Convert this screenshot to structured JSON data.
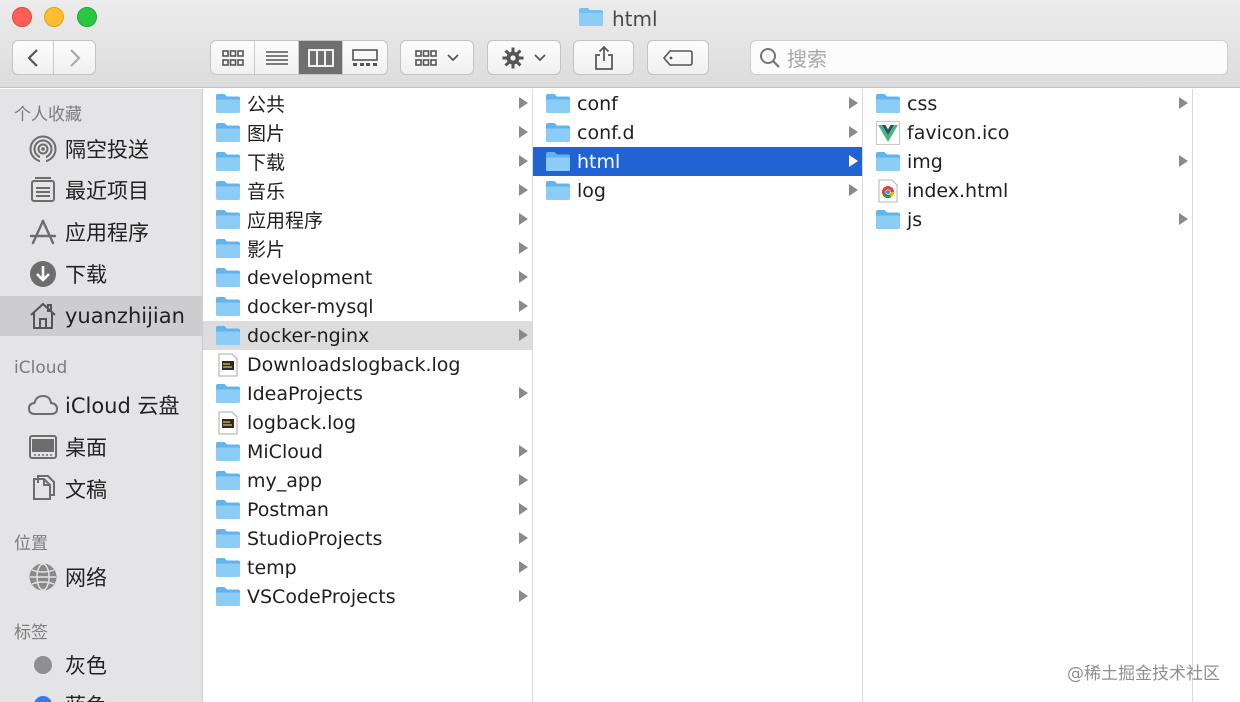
{
  "window": {
    "title": "html"
  },
  "toolbar": {
    "back_icon": "chevron-left-icon",
    "forward_icon": "chevron-right-icon",
    "view_modes": [
      "icon-view",
      "list-view",
      "column-view",
      "gallery-view"
    ],
    "active_view": "column-view",
    "group_icon": "grid-icon",
    "action_icon": "gear-icon",
    "share_icon": "share-icon",
    "tag_icon": "tag-icon",
    "search_placeholder": "搜索"
  },
  "sidebar": {
    "favorites_label": "个人收藏",
    "favorites": [
      {
        "label": "隔空投送",
        "icon": "airdrop-icon"
      },
      {
        "label": "最近项目",
        "icon": "recents-icon"
      },
      {
        "label": "应用程序",
        "icon": "applications-icon"
      },
      {
        "label": "下载",
        "icon": "downloads-icon"
      },
      {
        "label": "yuanzhijian",
        "icon": "home-icon",
        "selected": true
      }
    ],
    "icloud_label": "iCloud",
    "icloud": [
      {
        "label": "iCloud 云盘",
        "icon": "cloud-icon"
      },
      {
        "label": "桌面",
        "icon": "desktop-icon"
      },
      {
        "label": "文稿",
        "icon": "documents-icon"
      }
    ],
    "locations_label": "位置",
    "locations": [
      {
        "label": "网络",
        "icon": "network-icon"
      }
    ],
    "tags_label": "标签",
    "tags": [
      {
        "label": "灰色",
        "color": "#8e8e93"
      },
      {
        "label": "蓝色",
        "color": "#3478f6"
      }
    ]
  },
  "columns": [
    {
      "items": [
        {
          "name": "公共",
          "type": "folder",
          "arrow": true
        },
        {
          "name": "图片",
          "type": "folder",
          "arrow": true
        },
        {
          "name": "下载",
          "type": "folder",
          "arrow": true
        },
        {
          "name": "音乐",
          "type": "folder",
          "arrow": true
        },
        {
          "name": "应用程序",
          "type": "folder",
          "arrow": true
        },
        {
          "name": "影片",
          "type": "folder",
          "arrow": true
        },
        {
          "name": "development",
          "type": "folder",
          "arrow": true
        },
        {
          "name": "docker-mysql",
          "type": "folder",
          "arrow": true
        },
        {
          "name": "docker-nginx",
          "type": "folder",
          "arrow": true,
          "selected": "gray"
        },
        {
          "name": "Downloadslogback.log",
          "type": "log",
          "arrow": false
        },
        {
          "name": "IdeaProjects",
          "type": "folder",
          "arrow": true
        },
        {
          "name": "logback.log",
          "type": "log",
          "arrow": false
        },
        {
          "name": "MiCloud",
          "type": "folder",
          "arrow": true
        },
        {
          "name": "my_app",
          "type": "folder",
          "arrow": true
        },
        {
          "name": "Postman",
          "type": "folder",
          "arrow": true
        },
        {
          "name": "StudioProjects",
          "type": "folder",
          "arrow": true
        },
        {
          "name": "temp",
          "type": "folder",
          "arrow": true
        },
        {
          "name": "VSCodeProjects",
          "type": "folder",
          "arrow": true
        }
      ]
    },
    {
      "items": [
        {
          "name": "conf",
          "type": "folder",
          "arrow": true
        },
        {
          "name": "conf.d",
          "type": "folder",
          "arrow": true
        },
        {
          "name": "html",
          "type": "folder",
          "arrow": true,
          "selected": "blue"
        },
        {
          "name": "log",
          "type": "folder",
          "arrow": true
        }
      ]
    },
    {
      "items": [
        {
          "name": "css",
          "type": "folder",
          "arrow": true
        },
        {
          "name": "favicon.ico",
          "type": "vue",
          "arrow": false
        },
        {
          "name": "img",
          "type": "folder",
          "arrow": true
        },
        {
          "name": "index.html",
          "type": "chrome",
          "arrow": false
        },
        {
          "name": "js",
          "type": "folder",
          "arrow": true
        }
      ]
    }
  ],
  "watermark": "@稀土掘金技术社区",
  "colors": {
    "selection_blue": "#2163d2",
    "folder_blue": "#6fbdf2"
  }
}
